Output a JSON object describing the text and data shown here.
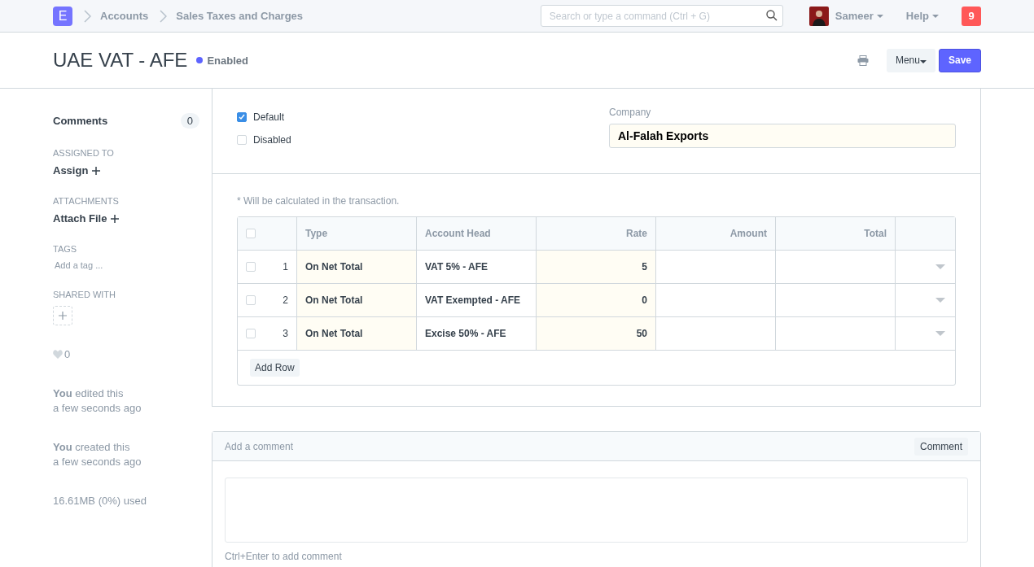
{
  "navbar": {
    "logo": "E",
    "breadcrumbs": [
      "Accounts",
      "Sales Taxes and Charges"
    ],
    "search": {
      "placeholder": "Search or type a command (Ctrl + G)"
    },
    "user": "Sameer",
    "help": "Help",
    "notifications": "9"
  },
  "header": {
    "title": "UAE VAT - AFE",
    "status": "Enabled",
    "buttons": [
      "Menu",
      "Save"
    ]
  },
  "sidebar": {
    "comments": {
      "label": "Comments",
      "count": "0"
    },
    "sections": [
      {
        "kind": "action",
        "heading": "ASSIGNED TO",
        "label": "Assign"
      },
      {
        "kind": "action",
        "heading": "ATTACHMENTS",
        "label": "Attach File"
      },
      {
        "kind": "tags",
        "heading": "TAGS",
        "label": "Add a tag ..."
      },
      {
        "kind": "share",
        "heading": "SHARED WITH"
      }
    ],
    "likes": "0",
    "activity": [
      {
        "actor": "You",
        "action": "edited this",
        "time": "a few seconds ago"
      },
      {
        "actor": "You",
        "action": "created this",
        "time": "a few seconds ago"
      }
    ],
    "storage": "16.61MB (0%) used"
  },
  "form": {
    "checkboxes": [
      {
        "label": "Default",
        "checked": true
      },
      {
        "label": "Disabled",
        "checked": false
      }
    ],
    "company": {
      "label": "Company",
      "value": "Al-Falah Exports"
    },
    "note": "* Will be calculated in the transaction.",
    "table": {
      "all_checked": false,
      "columns": [
        "Type",
        "Account Head",
        "Rate",
        "Amount",
        "Total"
      ],
      "rows": [
        {
          "checked": false,
          "index": "1",
          "type": "On Net Total",
          "account_head": "VAT 5% - AFE",
          "rate": "5"
        },
        {
          "checked": false,
          "index": "2",
          "type": "On Net Total",
          "account_head": "VAT Exempted - AFE",
          "rate": "0"
        },
        {
          "checked": false,
          "index": "3",
          "type": "On Net Total",
          "account_head": "Excise 50% - AFE",
          "rate": "50"
        }
      ],
      "add_row": "Add Row"
    }
  },
  "comment": {
    "heading": "Add a comment",
    "button": "Comment",
    "hint": "Ctrl+Enter to add comment"
  }
}
